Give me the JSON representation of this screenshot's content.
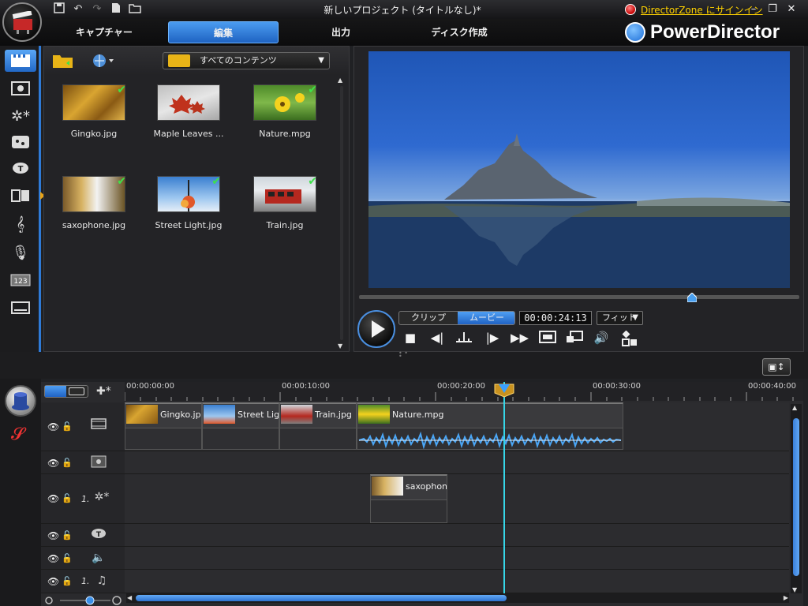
{
  "window": {
    "title": "新しいプロジェクト (タイトルなし)*",
    "signin_text": "DirectorZone にサインイン",
    "brand": "PowerDirector"
  },
  "quick_access": {
    "icons": [
      "save-icon",
      "undo-icon",
      "redo-icon",
      "new-project-icon",
      "open-folder-icon"
    ]
  },
  "main_tabs": [
    {
      "label": "キャプチャー",
      "active": false
    },
    {
      "label": "編集",
      "active": true
    },
    {
      "label": "出力",
      "active": false
    },
    {
      "label": "ディスク作成",
      "active": false
    }
  ],
  "sidebar": {
    "icons": [
      "media-room-icon",
      "effect-room-icon",
      "pip-objects-icon",
      "particle-room-icon",
      "title-room-icon",
      "transition-room-icon",
      "audio-mixing-icon",
      "voice-over-icon",
      "chapter-room-icon",
      "subtitle-room-icon"
    ]
  },
  "library": {
    "filter_value": "すべてのコンテンツ",
    "items": [
      {
        "name": "Gingko.jpg",
        "checked": true
      },
      {
        "name": "Maple Leaves ...",
        "checked": false
      },
      {
        "name": "Nature.mpg",
        "checked": true
      },
      {
        "name": "saxophone.jpg",
        "checked": true
      },
      {
        "name": "Street Light.jpg",
        "checked": true
      },
      {
        "name": "Train.jpg",
        "checked": true
      }
    ]
  },
  "preview": {
    "mode_clip": "クリップ",
    "mode_movie": "ムービー",
    "timecode": "00:00:24:13",
    "fit_label": "フィット",
    "scrub_position": 0.76
  },
  "timeline": {
    "ruler_labels": [
      "00:00:00:00",
      "00:00:10:00",
      "00:00:20:00",
      "00:00:30:00",
      "00:00:40:00"
    ],
    "video_clips": [
      {
        "label": "Gingko.jpg"
      },
      {
        "label": "Street Light.jpg"
      },
      {
        "label": "Train.jpg"
      },
      {
        "label": "Nature.mpg"
      }
    ],
    "pip_clip": {
      "label": "saxophone.jpg"
    },
    "track_number_1": "1.",
    "track_number_2": "1.",
    "playhead_time_seconds": 24.5
  },
  "colors": {
    "accent": "#2e7ad6",
    "playhead": "#36d6e8",
    "check": "#3ee24a",
    "signin": "#ffd200"
  }
}
